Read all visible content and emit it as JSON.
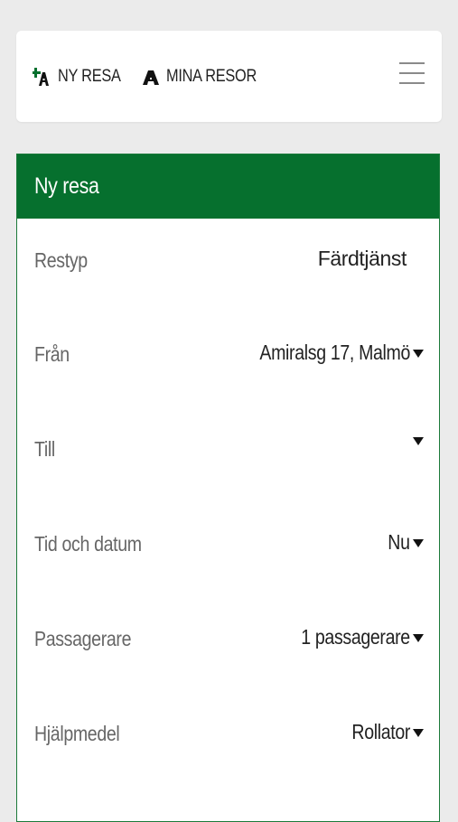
{
  "nav": {
    "new_trip_label": "NY RESA",
    "new_trip_icon": "new-trip-icon",
    "my_trips_label": "MINA RESOR",
    "my_trips_icon": "my-trips-icon",
    "menu_icon": "hamburger-menu-icon"
  },
  "panel": {
    "title": "Ny resa",
    "header_color": "#06702e",
    "rows": [
      {
        "label": "Restyp",
        "value": "Färdtjänst",
        "dropdown": false
      },
      {
        "label": "Från",
        "value": "Amiralsg 17, Malmö",
        "dropdown": true
      },
      {
        "label": "Till",
        "value": "",
        "dropdown": true
      },
      {
        "label": "Tid och datum",
        "value": "Nu",
        "dropdown": true
      },
      {
        "label": "Passagerare",
        "value": "1 passagerare",
        "dropdown": true
      },
      {
        "label": "Hjälpmedel",
        "value": "Rollator",
        "dropdown": true
      }
    ]
  }
}
